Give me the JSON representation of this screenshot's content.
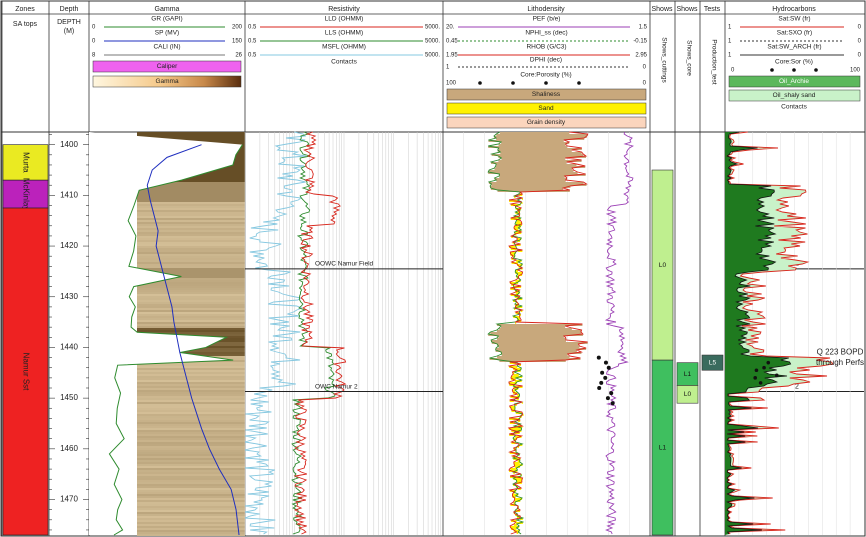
{
  "tracks": {
    "zones": {
      "title": "Zones",
      "subtitle": "SA tops"
    },
    "depth": {
      "title": "Depth",
      "subtitle": "DEPTH",
      "subtitle2": "(M)"
    },
    "gamma": {
      "title": "Gamma"
    },
    "resistivity": {
      "title": "Resistivity",
      "contacts_label": "Contacts"
    },
    "lithodensity": {
      "title": "Lithodensity"
    },
    "shoes_cuttings": {
      "title": "Shows",
      "vertical": "Shows_cuttings"
    },
    "shoes_core": {
      "title": "Shows",
      "vertical": "Shows_core"
    },
    "tests": {
      "title": "Tests",
      "vertical": "Production_test"
    },
    "hydrocarbons": {
      "title": "Hydrocarbons",
      "contacts_label": "Contacts"
    }
  },
  "curves": {
    "gr": {
      "name": "GR (GAPI)",
      "min": "0",
      "max": "200",
      "color": "#2e8b2e"
    },
    "sp": {
      "name": "SP (MV)",
      "min": "0",
      "max": "150",
      "color": "#1f2fbf"
    },
    "cali": {
      "name": "CALI (IN)",
      "min": "8",
      "max": "26",
      "color": "#777777"
    },
    "lld": {
      "name": "LLD (OHMM)",
      "min": "0.5",
      "max": "5000.",
      "color": "#d8261c"
    },
    "lls": {
      "name": "LLS (OHMM)",
      "min": "0.5",
      "max": "5000.",
      "color": "#2e8b2e"
    },
    "msfl": {
      "name": "MSFL (OHMM)",
      "min": "0.5",
      "max": "5000.",
      "color": "#86c8e0"
    },
    "pef": {
      "name": "PEF (b/e)",
      "min": "20.",
      "max": "1.5",
      "color": "#9b3fb5"
    },
    "nphi": {
      "name": "NPHI_ss (dec)",
      "min": "0.45",
      "max": "-0.15",
      "color": "#2e8b2e"
    },
    "rhob": {
      "name": "RHOB (G/C3)",
      "min": "1.95",
      "max": "2.95",
      "color": "#d8261c"
    },
    "dphi": {
      "name": "DPHI (dec)",
      "min": "1",
      "max": "0",
      "color": "#333333"
    },
    "core_por": {
      "name": "Core:Porosity (%)",
      "min": "100",
      "max": "0"
    },
    "sw": {
      "name": "Sat:SW (fr)",
      "min": "1",
      "max": "0",
      "color": "#d8261c"
    },
    "sxo": {
      "name": "Sat:SXO (fr)",
      "min": "1",
      "max": "0",
      "color": "#333333"
    },
    "sw_arch": {
      "name": "Sat:SW_ARCH (fr)",
      "min": "1",
      "max": "0",
      "color": "#333333"
    },
    "core_sor": {
      "name": "Core:Sor (%)",
      "min": "0",
      "max": "100"
    }
  },
  "fills": {
    "caliper": {
      "label": "Caliper",
      "color": "#ef62ef"
    },
    "gamma": {
      "label": "Gamma"
    },
    "shaliness": {
      "label": "Shaliness",
      "color": "#c8a87c"
    },
    "sand": {
      "label": "Sand",
      "color": "#fff200"
    },
    "grain_density": {
      "label": "Grain density",
      "color": "#fbd5bd"
    },
    "oil_archie": {
      "label": "Oil_Archie",
      "color": "#5cb85c"
    },
    "oil_shaly_sand": {
      "label": "Oil_shaly sand",
      "color": "#c9f2c9"
    }
  },
  "zones": [
    {
      "name": "Murta",
      "top": 1400,
      "base": 1407,
      "color": "#eaea22"
    },
    {
      "name": "McKinlay",
      "top": 1407,
      "base": 1412.5,
      "color": "#bb22bb"
    },
    {
      "name": "Namur Sst",
      "top": 1412.5,
      "base": 1477,
      "color": "#ee2222"
    }
  ],
  "depth_ticks": [
    1400,
    1410,
    1420,
    1430,
    1440,
    1450,
    1460,
    1470
  ],
  "contacts": [
    {
      "label": "OOWC Namur Field",
      "depth": 1424.5,
      "hc_label": "1"
    },
    {
      "label": "OWC Namur 2",
      "depth": 1448.7,
      "hc_label": "2"
    }
  ],
  "shows_cuttings": [
    {
      "label": "L0",
      "top": 1405,
      "base": 1442.5,
      "color": "#bfef8f"
    },
    {
      "label": "L1",
      "top": 1442.5,
      "base": 1477,
      "color": "#3fbf5f"
    }
  ],
  "shows_core": [
    {
      "label": "L1",
      "top": 1443,
      "base": 1447.5,
      "color": "#3fbf5f"
    },
    {
      "label": "L0",
      "top": 1447.5,
      "base": 1451,
      "color": "#bfef8f"
    }
  ],
  "tests": [
    {
      "label": "L5",
      "top": 1441.5,
      "base": 1444.5,
      "color": "#3a6b5e"
    }
  ],
  "annotation": {
    "line1": "Q 223 BOPD",
    "line2": "through Perfs"
  },
  "depth_range": [
    1397.5,
    1477
  ],
  "chart_data": {
    "type": "line",
    "title": "",
    "ylabel": "DEPTH (M)",
    "ylim": [
      1397.5,
      1477
    ],
    "series": [
      {
        "name": "GR (GAPI)",
        "x": [
          200,
          195,
          190,
          120,
          60,
          55,
          50,
          60,
          55,
          50,
          120,
          55,
          50,
          60,
          55,
          50,
          60,
          180,
          150,
          120,
          190,
          35,
          30,
          40,
          35,
          30,
          40,
          25,
          35,
          30,
          40,
          35,
          30,
          40,
          30
        ],
        "y": [
          1400,
          1402,
          1404,
          1407,
          1409,
          1412,
          1415,
          1418,
          1421,
          1424,
          1426,
          1428,
          1430,
          1432,
          1434,
          1436,
          1437,
          1438,
          1440,
          1441,
          1442.5,
          1443.5,
          1446,
          1449,
          1452,
          1455,
          1458,
          1461,
          1464,
          1467,
          1470,
          1472,
          1474,
          1476,
          1477
        ]
      },
      {
        "name": "SP (MV)",
        "x": [
          110,
          75,
          60,
          55,
          58,
          62,
          66,
          64,
          68,
          72,
          76,
          80,
          82,
          85,
          88,
          92,
          96,
          100,
          105,
          110,
          118,
          128,
          140,
          145,
          148
        ],
        "y": [
          1400,
          1402.5,
          1405,
          1408,
          1411,
          1414,
          1417,
          1420,
          1423,
          1426,
          1429,
          1432,
          1435,
          1438,
          1441,
          1444,
          1447,
          1450,
          1453,
          1456,
          1460,
          1464,
          1468,
          1472,
          1477
        ]
      }
    ]
  }
}
